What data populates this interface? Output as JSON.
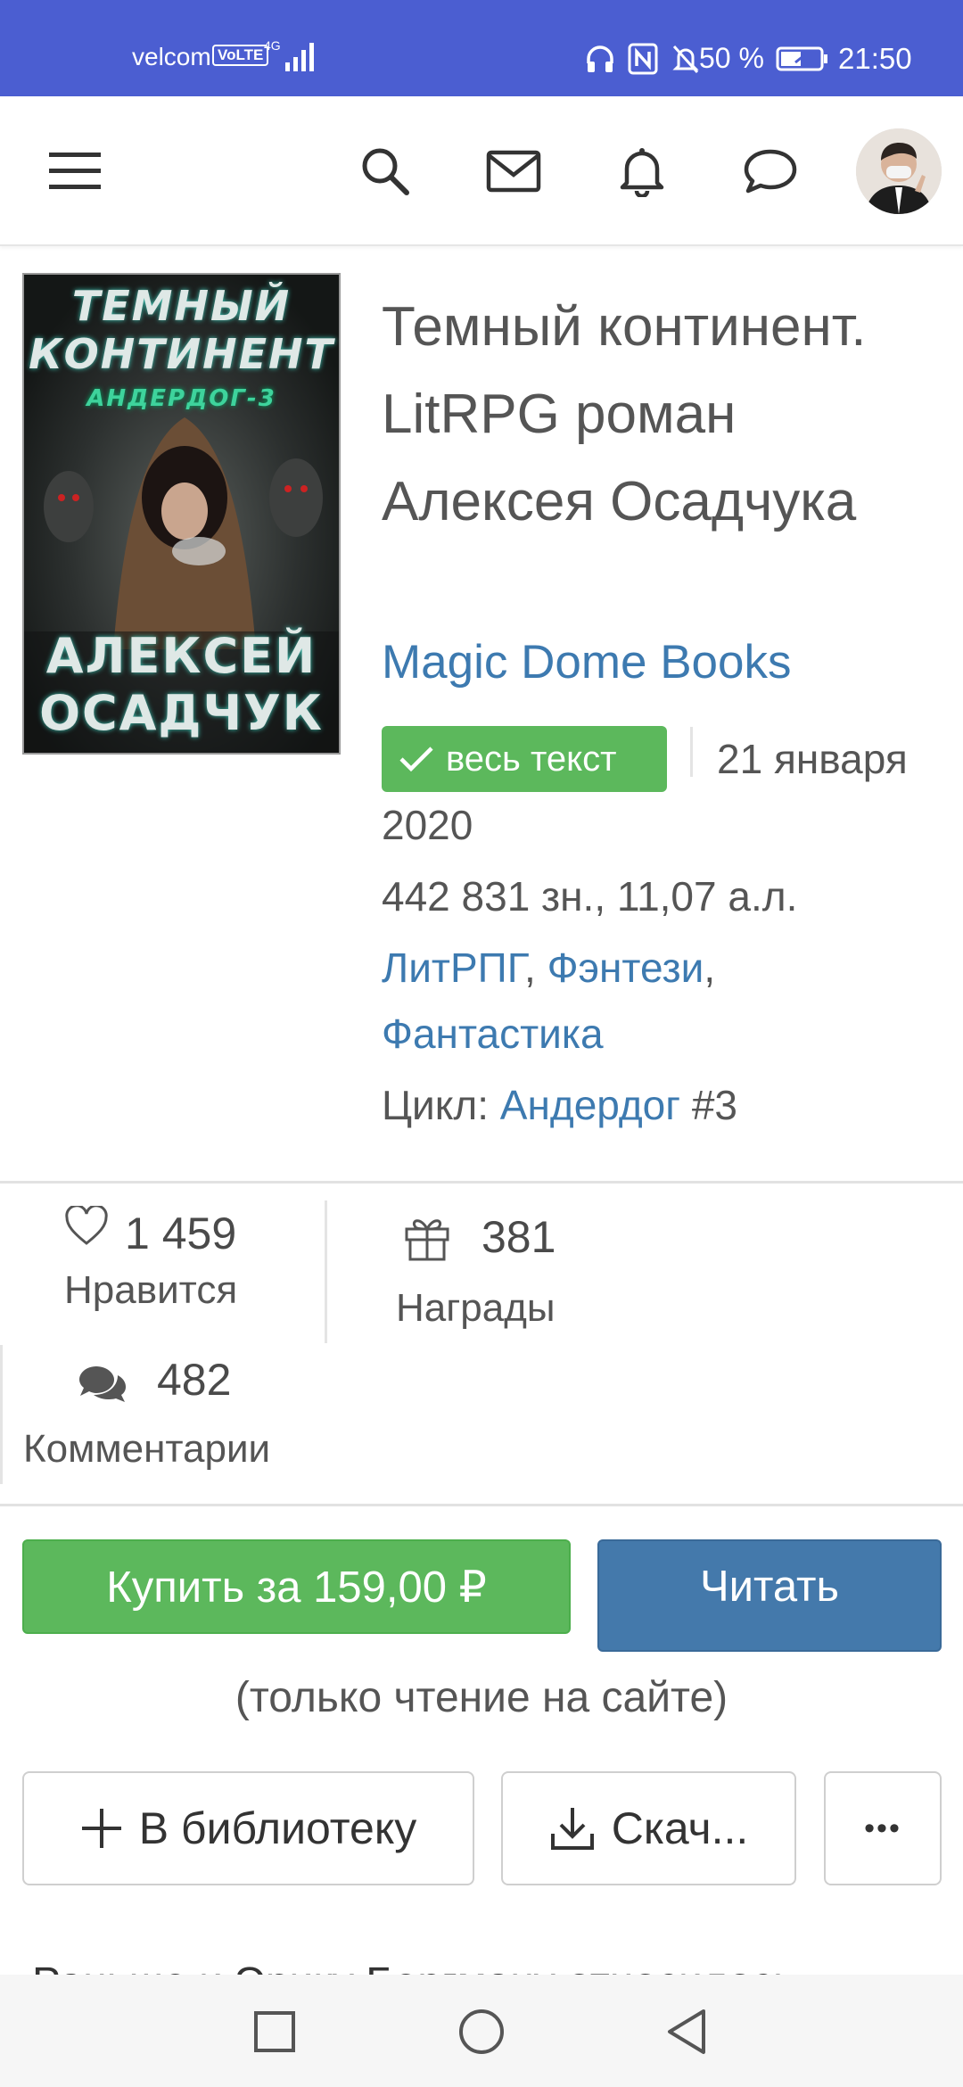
{
  "status_bar": {
    "carrier": "velcom",
    "volte": "VoLTE",
    "network": "4G",
    "battery_percent": "50 %",
    "time": "21:50",
    "icons": [
      "headphones-icon",
      "nfc-icon",
      "mute-icon",
      "battery-icon"
    ]
  },
  "header": {
    "icons": [
      "menu-icon",
      "search-icon",
      "mail-icon",
      "bell-icon",
      "chat-icon",
      "avatar"
    ]
  },
  "book": {
    "cover_text": {
      "title_line1": "ТЕМНЫЙ",
      "title_line2": "КОНТИНЕНТ",
      "series": "АНДЕРДОГ-3",
      "author_line1": "АЛЕКСЕЙ",
      "author_line2": "ОСАДЧУК"
    },
    "title": "Темный континент. LitRPG роман Алексея Осадчука",
    "publisher": "Magic Dome Books",
    "status_badge": "весь текст",
    "date_part1": "21 января",
    "date_part2": "2020",
    "size": "442 831 зн., 11,07 а.л.",
    "genres": [
      "ЛитРПГ",
      "Фэнтези",
      "Фантастика"
    ],
    "cycle_label": "Цикл:",
    "cycle_name": "Андердог",
    "cycle_number": "#3"
  },
  "stats": {
    "likes_count": "1 459",
    "likes_label": "Нравится",
    "awards_count": "381",
    "awards_label": "Награды",
    "comments_count": "482",
    "comments_label": "Комментарии"
  },
  "actions": {
    "buy_label": "Купить за 159,00 ₽",
    "read_label": "Читать",
    "read_note": "(только чтение на сайте)",
    "library_label": "В библиотеку",
    "download_label": "Скач...",
    "more_label": "•••"
  },
  "description_peek": "Раньше и Эрику Бергману относилось",
  "colors": {
    "status_bar": "#4b5ed1",
    "green": "#5cb85c",
    "blue_button": "#4479ab",
    "link": "#3d7ab0"
  }
}
